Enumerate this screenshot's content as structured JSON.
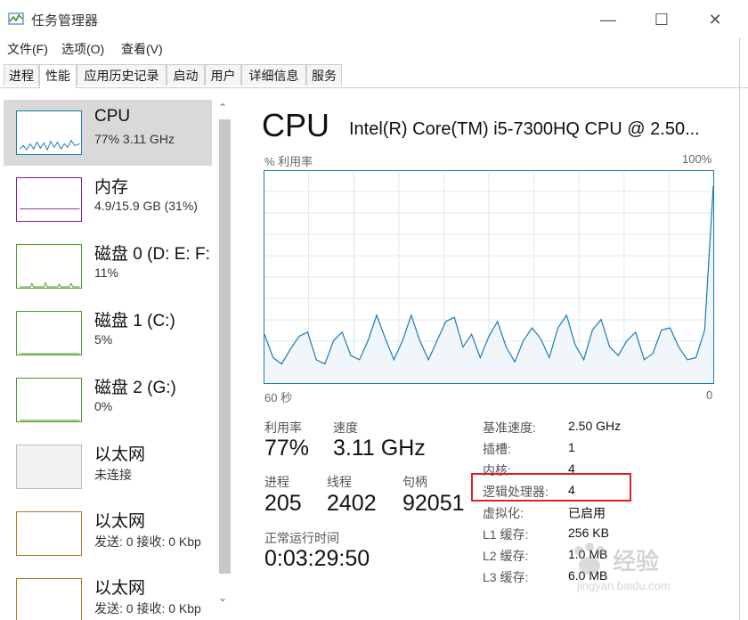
{
  "window": {
    "title": "任务管理器",
    "minimize_glyph": "—",
    "maximize_glyph": "☐",
    "close_glyph": "✕"
  },
  "menu": [
    "文件(F)",
    "选项(O)",
    "查看(V)"
  ],
  "tabs": [
    {
      "label": "进程",
      "active": false
    },
    {
      "label": "性能",
      "active": true
    },
    {
      "label": "应用历史记录",
      "active": false
    },
    {
      "label": "启动",
      "active": false
    },
    {
      "label": "用户",
      "active": false
    },
    {
      "label": "详细信息",
      "active": false
    },
    {
      "label": "服务",
      "active": false
    }
  ],
  "sidebar": {
    "items": [
      {
        "title": "CPU",
        "sub": "77%  3.11 GHz",
        "color": "#1a7ab8",
        "active": true
      },
      {
        "title": "内存",
        "sub": "4.9/15.9 GB (31%)",
        "color": "#8b1a8b",
        "active": false
      },
      {
        "title": "磁盘 0 (D: E: F:",
        "sub": "11%",
        "color": "#4c9a2a",
        "active": false
      },
      {
        "title": "磁盘 1 (C:)",
        "sub": "5%",
        "color": "#4c9a2a",
        "active": false
      },
      {
        "title": "磁盘 2 (G:)",
        "sub": "0%",
        "color": "#4c9a2a",
        "active": false
      },
      {
        "title": "以太网",
        "sub": "未连接",
        "color": "#bbbbbb",
        "active": false
      },
      {
        "title": "以太网",
        "sub": "发送: 0 接收: 0 Kbp",
        "color": "#b07a1a",
        "active": false
      },
      {
        "title": "以太网",
        "sub": "发送: 0 接收: 0 Kbp",
        "color": "#b07a1a",
        "active": false
      }
    ],
    "scroll_up": "⌃",
    "scroll_down": "⌄"
  },
  "main": {
    "title": "CPU",
    "model": "Intel(R) Core(TM) i5-7300HQ CPU @ 2.50...",
    "util_label": "% 利用率",
    "max_label": "100%",
    "time_left": "60 秒",
    "time_right": "0",
    "graph_color": "#1a7ab8",
    "graph_fill": "#f1f6fa",
    "graph_values": [
      23,
      12,
      9,
      16,
      22,
      24,
      11,
      9,
      20,
      24,
      13,
      11,
      20,
      32,
      21,
      11,
      20,
      32,
      20,
      11,
      20,
      29,
      31,
      17,
      23,
      12,
      22,
      29,
      17,
      10,
      20,
      26,
      21,
      12,
      26,
      32,
      18,
      11,
      25,
      30,
      17,
      13,
      20,
      24,
      11,
      14,
      25,
      26,
      17,
      11,
      12,
      25,
      93
    ],
    "stats": {
      "util_label": "利用率",
      "util_value": "77%",
      "speed_label": "速度",
      "speed_value": "3.11 GHz",
      "proc_label": "进程",
      "proc_value": "205",
      "thread_label": "线程",
      "thread_value": "2402",
      "handle_label": "句柄",
      "handle_value": "92051",
      "uptime_label": "正常运行时间",
      "uptime_value": "0:03:29:50"
    },
    "specs": [
      {
        "label": "基准速度:",
        "value": "2.50 GHz"
      },
      {
        "label": "插槽:",
        "value": "1"
      },
      {
        "label": "内核:",
        "value": "4"
      },
      {
        "label": "逻辑处理器:",
        "value": "4"
      },
      {
        "label": "虚拟化:",
        "value": "已启用"
      },
      {
        "label": "L1 缓存:",
        "value": "256 KB"
      },
      {
        "label": "L2 缓存:",
        "value": "1.0 MB"
      },
      {
        "label": "L3 缓存:",
        "value": "6.0 MB"
      }
    ],
    "highlight_color": "#e02020"
  },
  "watermark": {
    "text": "经验",
    "sub": "jingyan.baidu.com"
  }
}
